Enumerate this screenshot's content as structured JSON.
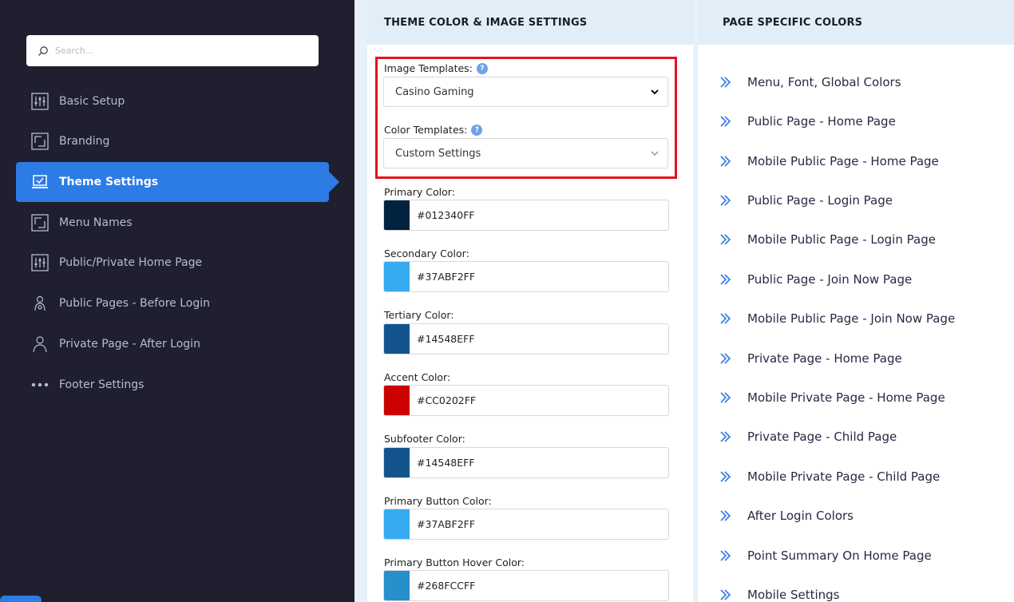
{
  "sidebar": {
    "search_placeholder": "Search...",
    "items": [
      {
        "label": "Basic Setup",
        "icon": "sliders-icon"
      },
      {
        "label": "Branding",
        "icon": "frame-icon"
      },
      {
        "label": "Theme Settings",
        "icon": "laptop-check-icon",
        "active": true
      },
      {
        "label": "Menu Names",
        "icon": "frame-icon"
      },
      {
        "label": "Public/Private Home Page",
        "icon": "sliders-icon"
      },
      {
        "label": "Public Pages - Before Login",
        "icon": "user-gear-icon"
      },
      {
        "label": "Private Page - After Login",
        "icon": "user-icon"
      },
      {
        "label": "Footer Settings",
        "icon": "more-dots-icon"
      }
    ]
  },
  "theme_panel": {
    "title": "THEME COLOR & IMAGE SETTINGS",
    "image_templates": {
      "label": "Image Templates:",
      "selected": "Casino Gaming"
    },
    "color_templates": {
      "label": "Color Templates:",
      "selected": "Custom Settings"
    },
    "colors": [
      {
        "label": "Primary Color:",
        "hex": "#012340FF",
        "swatch": "#012340"
      },
      {
        "label": "Secondary Color:",
        "hex": "#37ABF2FF",
        "swatch": "#37abf2"
      },
      {
        "label": "Tertiary Color:",
        "hex": "#14548EFF",
        "swatch": "#14548e"
      },
      {
        "label": "Accent Color:",
        "hex": "#CC0202FF",
        "swatch": "#cc0202"
      },
      {
        "label": "Subfooter Color:",
        "hex": "#14548EFF",
        "swatch": "#14548e"
      },
      {
        "label": "Primary Button Color:",
        "hex": "#37ABF2FF",
        "swatch": "#37abf2"
      },
      {
        "label": "Primary Button Hover Color:",
        "hex": "#268FCCFF",
        "swatch": "#268fcc"
      }
    ]
  },
  "page_colors": {
    "title": "PAGE SPECIFIC COLORS",
    "links": [
      "Menu, Font, Global Colors",
      "Public Page - Home Page",
      "Mobile Public Page - Home Page",
      "Public Page - Login Page",
      "Mobile Public Page - Login Page",
      "Public Page - Join Now Page",
      "Mobile Public Page - Join Now Page",
      "Private Page - Home Page",
      "Mobile Private Page - Home Page",
      "Private Page - Child Page",
      "Mobile Private Page - Child Page",
      "After Login Colors",
      "Point Summary On Home Page",
      "Mobile Settings"
    ]
  },
  "colors": {
    "sidebar_bg": "#1f1f30",
    "active": "#2d7be5",
    "header_bg": "#e2eef7",
    "highlight": "#e2141b",
    "link_arrow": "#2d7be5"
  }
}
